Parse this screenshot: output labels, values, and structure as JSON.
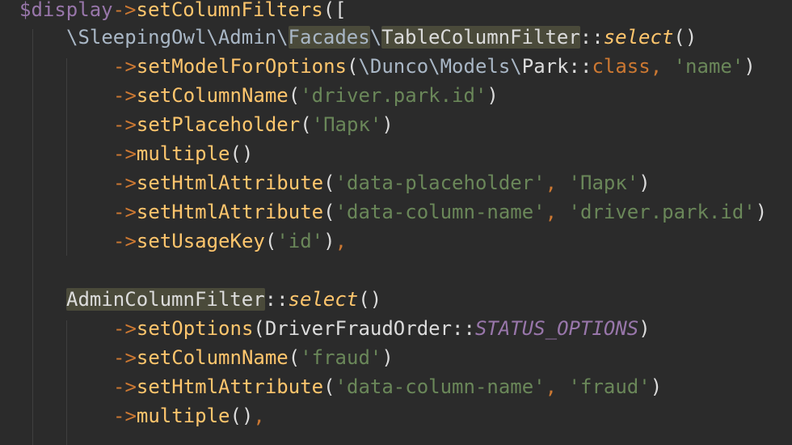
{
  "code": {
    "l1": {
      "var": "$display",
      "arrow": "->",
      "method": "setColumnFilters",
      "open": "(["
    },
    "l2": {
      "ns1": "\\SleepingOwl\\Admin\\",
      "ns2": "Facades",
      "ns3": "\\",
      "cls": "TableColumnFilter",
      "sep": "::",
      "method": "select",
      "paren": "()"
    },
    "l3": {
      "arrow": "->",
      "method": "setModelForOptions",
      "open": "(",
      "ns": "\\Dunco\\Models\\",
      "cls": "Park",
      "sep": "::",
      "kw": "class",
      "comma": ",",
      "str": " 'name'",
      "close": ")"
    },
    "l4": {
      "arrow": "->",
      "method": "setColumnName",
      "open": "(",
      "str": "'driver.park.id'",
      "close": ")"
    },
    "l5": {
      "arrow": "->",
      "method": "setPlaceholder",
      "open": "(",
      "str": "'Парк'",
      "close": ")"
    },
    "l6": {
      "arrow": "->",
      "method": "multiple",
      "paren": "()"
    },
    "l7": {
      "arrow": "->",
      "method": "setHtmlAttribute",
      "open": "(",
      "str1": "'data-placeholder'",
      "comma": ",",
      "str2": " 'Парк'",
      "close": ")"
    },
    "l8": {
      "arrow": "->",
      "method": "setHtmlAttribute",
      "open": "(",
      "str1": "'data-column-name'",
      "comma": ",",
      "str2": " 'driver.park.id'",
      "close": ")"
    },
    "l9": {
      "arrow": "->",
      "method": "setUsageKey",
      "open": "(",
      "str": "'id'",
      "close": ")",
      "comma": ","
    },
    "l11": {
      "cls": "AdminColumnFilter",
      "sep": "::",
      "method": "select",
      "paren": "()"
    },
    "l12": {
      "arrow": "->",
      "method": "setOptions",
      "open": "(",
      "cls": "DriverFraudOrder",
      "sep": "::",
      "const": "STATUS_OPTIONS",
      "close": ")"
    },
    "l13": {
      "arrow": "->",
      "method": "setColumnName",
      "open": "(",
      "str": "'fraud'",
      "close": ")"
    },
    "l14": {
      "arrow": "->",
      "method": "setHtmlAttribute",
      "open": "(",
      "str1": "'data-column-name'",
      "comma": ",",
      "str2": " 'fraud'",
      "close": ")"
    },
    "l15": {
      "arrow": "->",
      "method": "multiple",
      "paren": "()",
      "comma": ","
    }
  }
}
